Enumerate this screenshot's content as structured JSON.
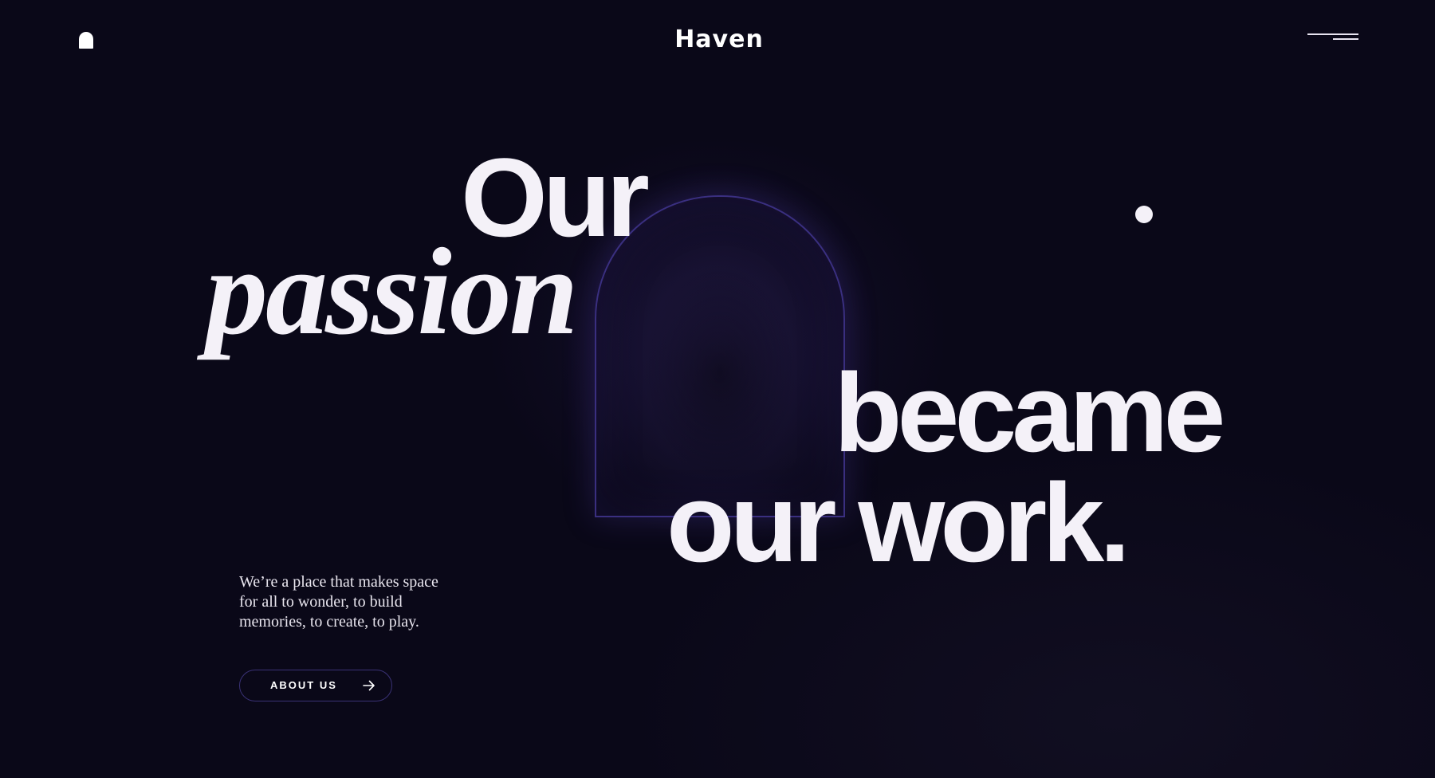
{
  "header": {
    "brand": "Haven",
    "logo_icon": "arch-icon",
    "menu_icon": "menu-icon"
  },
  "hero": {
    "line1": "Our",
    "line2": "passion",
    "line3": "became",
    "line4": "our work.",
    "intro": "We’re a place that makes space for all to wonder, to build memories, to create, to play.",
    "cta_label": "ABOUT US",
    "cta_icon": "arrow-right-icon"
  },
  "colors": {
    "background": "#0a0818",
    "text": "#f4f1f8",
    "arch_stroke": "#3a2f80",
    "button_border": "#3a3276"
  }
}
